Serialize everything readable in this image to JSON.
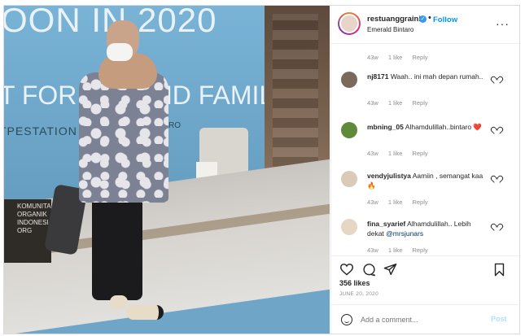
{
  "photo": {
    "wall_line1": "OON IN 2020",
    "wall_line2": "T FOR M     S AND FAMILY",
    "wall_line3": "TPESTATION",
    "wall_line4": "INTARO",
    "sign_text": "KOMUNITAS ORGANIK INDONESIA ORG"
  },
  "header": {
    "username": "restuanggraini",
    "verified_mark": "✓",
    "separator": "•",
    "follow_label": "Follow",
    "location": "Emerald Bintaro",
    "more_label": "···"
  },
  "top_meta": {
    "time": "43w",
    "likes": "1 like",
    "reply": "Reply"
  },
  "comments": [
    {
      "user": "nj8171",
      "text": "Waah.. ini mah depan rumah..",
      "mention": "",
      "time": "43w",
      "likes": "1 like",
      "reply": "Reply",
      "avatar_color": "#7a6a5c"
    },
    {
      "user": "mbning_05",
      "text": "Alhamdulillah..bintaro ❤️",
      "mention": "",
      "time": "43w",
      "likes": "1 like",
      "reply": "Reply",
      "avatar_color": "#5f8a3a"
    },
    {
      "user": "vendyjulistya",
      "text": "Aamiin , semangat kaa🔥",
      "mention": "",
      "time": "43w",
      "likes": "1 like",
      "reply": "Reply",
      "avatar_color": "#d9cbb8"
    },
    {
      "user": "fina_syarief",
      "text": "Alhamdulillah.. Lebih dekat",
      "mention": "@mrsjunars",
      "time": "43w",
      "likes": "1 like",
      "reply": "Reply",
      "avatar_color": "#e6d7c4"
    }
  ],
  "actions": {
    "like_icon": "heart-icon",
    "comment_icon": "comment-icon",
    "share_icon": "share-icon",
    "save_icon": "bookmark-icon"
  },
  "likes_text": "356 likes",
  "date_text": "JUNE 20, 2020",
  "add_comment": {
    "placeholder": "Add a comment...",
    "post_label": "Post"
  },
  "colors": {
    "accent": "#0095f6",
    "post_disabled": "#b2dffc",
    "text": "#262626",
    "muted": "#8e8e8e"
  }
}
